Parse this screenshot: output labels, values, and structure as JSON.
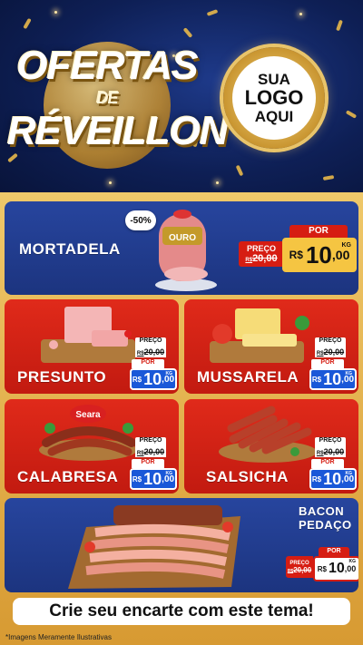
{
  "header": {
    "title_line1": "OFERTAS",
    "title_line2": "DE",
    "title_line3": "RÉVEILLON",
    "logo_line1": "SUA",
    "logo_line2": "LOGO",
    "logo_line3": "AQUI"
  },
  "products": {
    "mortadela": {
      "name": "MORTADELA",
      "discount": "-50%",
      "brand": "OURO",
      "preco_label": "PREÇO",
      "old_currency": "R$",
      "old_price": "20,00",
      "por_label": "POR",
      "currency": "R$",
      "price_int": "10",
      "price_dec": ",00",
      "unit": "KG"
    },
    "presunto": {
      "name": "PRESUNTO",
      "preco_label": "PREÇO",
      "old_currency": "R$",
      "old_price": "20,00",
      "por_label": "POR",
      "currency": "R$",
      "price_int": "10",
      "price_dec": ",00",
      "unit": "KG"
    },
    "mussarela": {
      "name": "MUSSARELA",
      "preco_label": "PREÇO",
      "old_currency": "R$",
      "old_price": "20,00",
      "por_label": "POR",
      "currency": "R$",
      "price_int": "10",
      "price_dec": ",00",
      "unit": "KG"
    },
    "calabresa": {
      "name": "CALABRESA",
      "brand": "Seara",
      "preco_label": "PREÇO",
      "old_currency": "R$",
      "old_price": "20,00",
      "por_label": "POR",
      "currency": "R$",
      "price_int": "10",
      "price_dec": ",00",
      "unit": "KG"
    },
    "salsicha": {
      "name": "SALSICHA",
      "preco_label": "PREÇO",
      "old_currency": "R$",
      "old_price": "20,00",
      "por_label": "POR",
      "currency": "R$",
      "price_int": "10",
      "price_dec": ",00",
      "unit": "KG"
    },
    "bacon": {
      "name_line1": "BACON",
      "name_line2": "PEDAÇO",
      "preco_label": "PREÇO",
      "old_currency": "R$",
      "old_price": "20,00",
      "por_label": "POR",
      "currency": "R$",
      "price_int": "10",
      "price_dec": ",00",
      "unit": "KG"
    }
  },
  "footer": {
    "cta": "Crie seu encarte com este tema!",
    "disclaimer": "*Imagens Meramente Ilustrativas"
  },
  "colors": {
    "blue_panel": "#1c347f",
    "red_panel": "#c21a10",
    "gold": "#d79a32",
    "price_blue": "#1a58d8"
  }
}
